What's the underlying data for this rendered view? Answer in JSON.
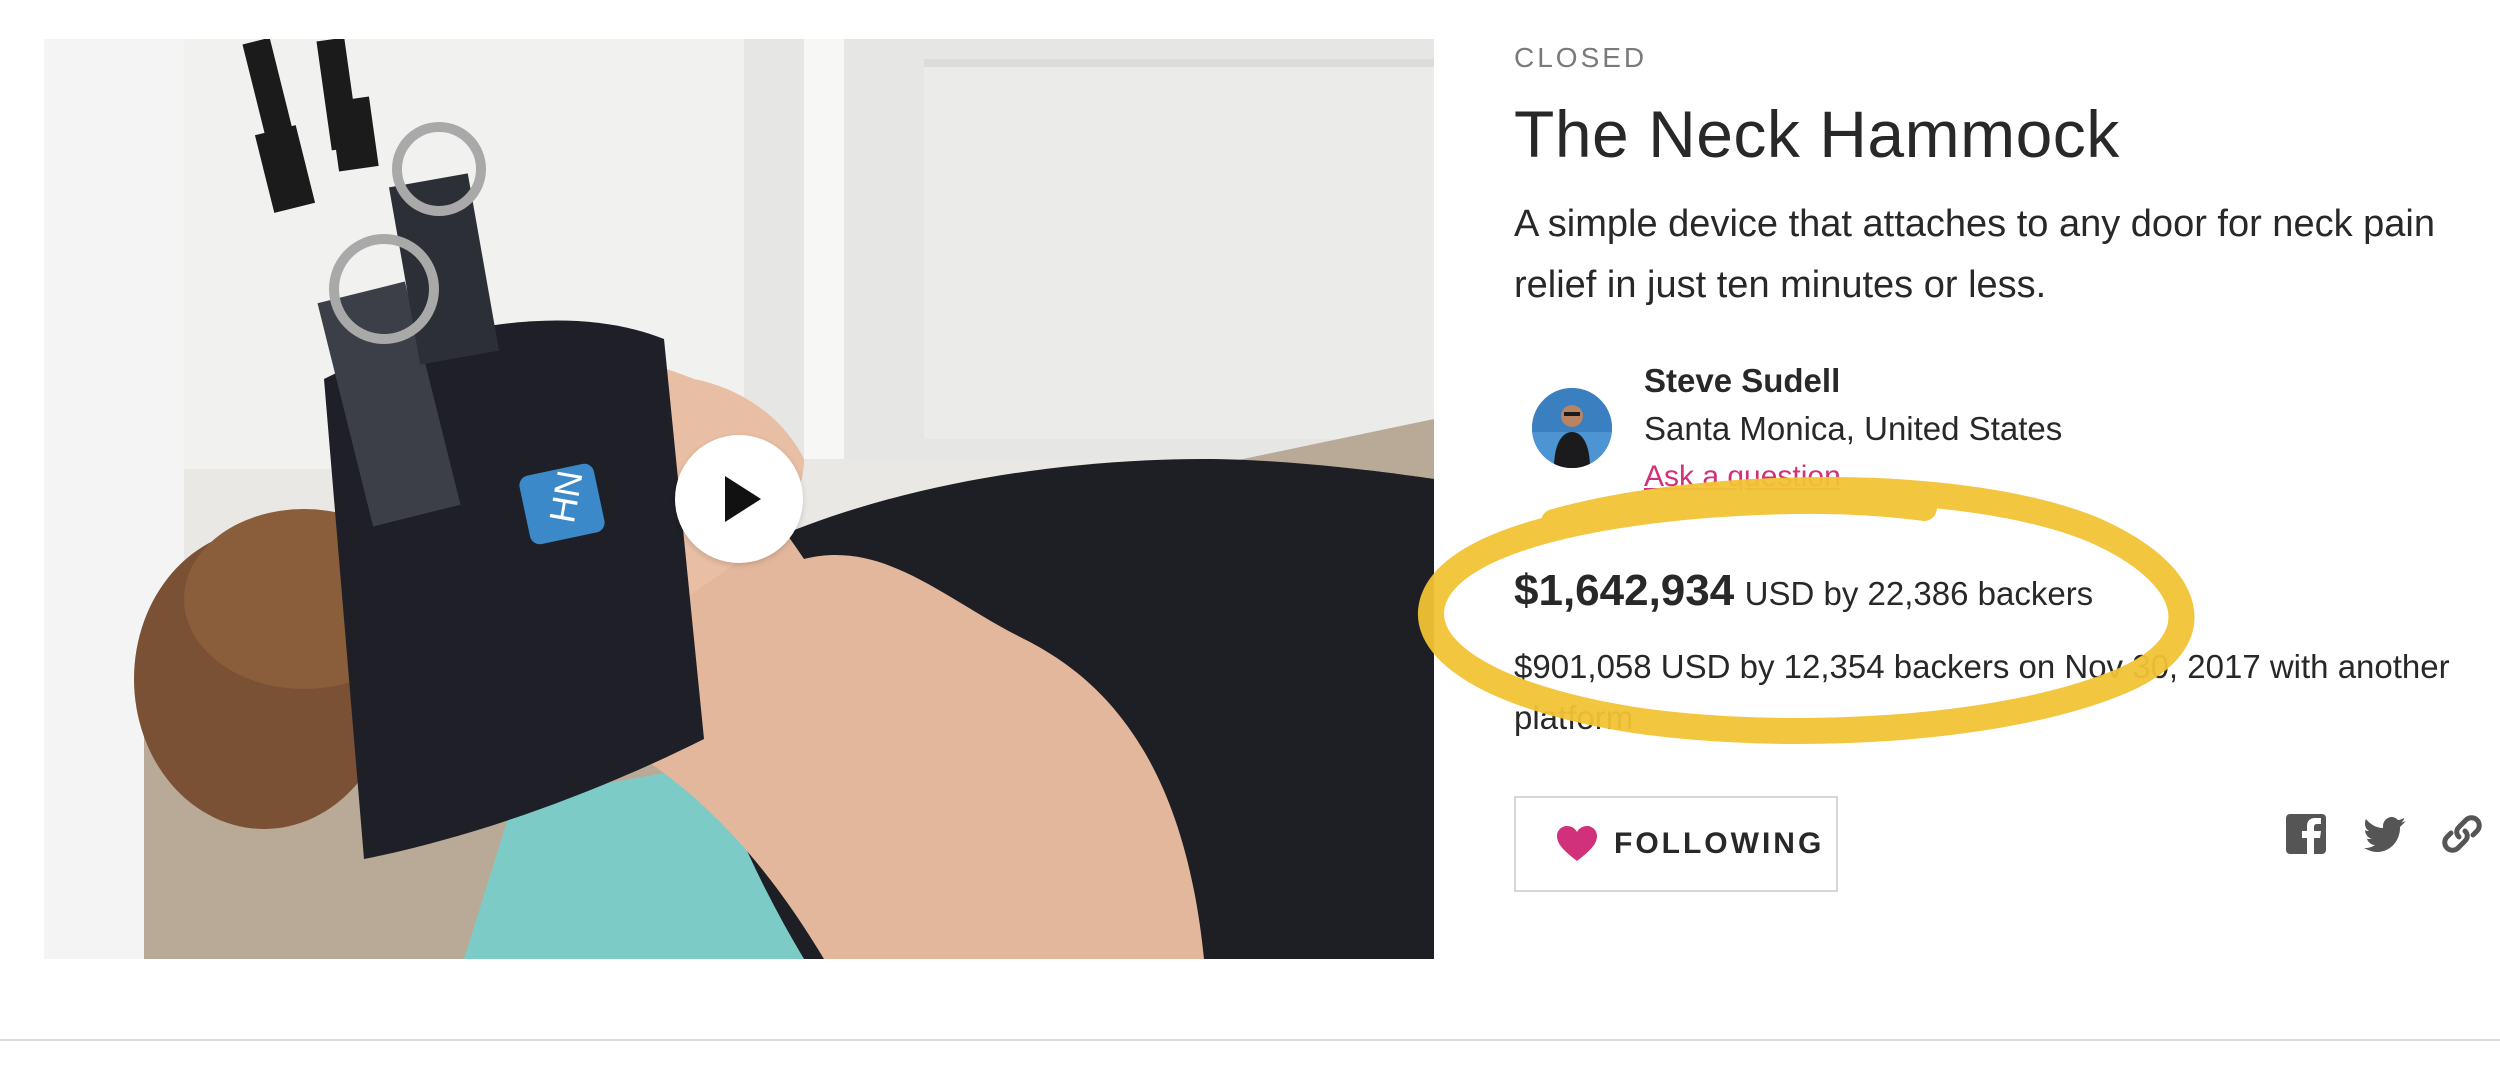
{
  "video": {
    "play_icon": "play-icon",
    "product_logo": "HN"
  },
  "campaign": {
    "status": "CLOSED",
    "title": "The Neck Hammock",
    "blurb": "A simple device that attaches to any door for neck pain relief in just ten minutes or less."
  },
  "creator": {
    "name": "Steve Sudell",
    "location": "Santa Monica, United States",
    "ask_link": "Ask a question"
  },
  "funding": {
    "amount": "$1,642,934",
    "meta": "USD by 22,386 backers",
    "other_platform": "$901,058 USD by 12,354 backers on Nov 30, 2017 with another platform"
  },
  "actions": {
    "follow_label": "FOLLOWING",
    "follow_icon": "heart-icon",
    "share_icons": [
      "facebook-icon",
      "twitter-icon",
      "link-icon"
    ]
  },
  "colors": {
    "accent_pink": "#d0317a",
    "highlight_yellow": "#f2c335",
    "text": "#282828",
    "muted": "#7a7a7a"
  }
}
